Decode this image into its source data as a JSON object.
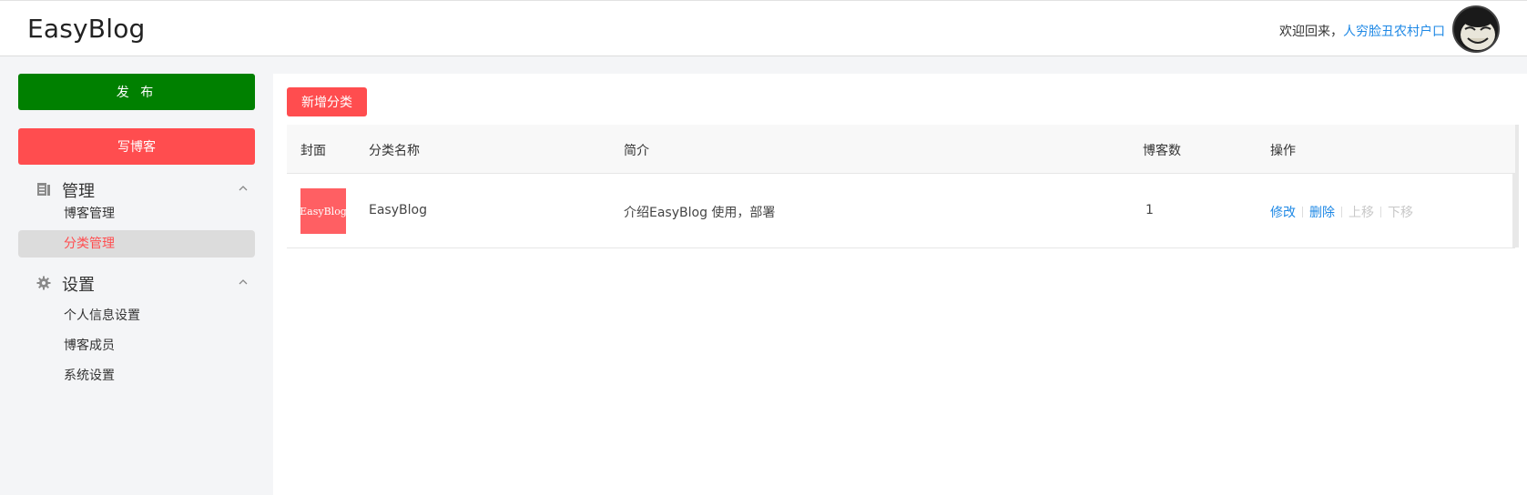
{
  "header": {
    "logo": "EasyBlog",
    "welcome_prefix": "欢迎回来，",
    "username": "人穷脸丑农村户口"
  },
  "sidebar": {
    "publish_label": "发 布",
    "write_label": "写博客",
    "groups": [
      {
        "label": "管理",
        "icon": "document-icon",
        "items": [
          {
            "label": "博客管理",
            "active": false
          },
          {
            "label": "分类管理",
            "active": true
          }
        ]
      },
      {
        "label": "设置",
        "icon": "gear-icon",
        "items": [
          {
            "label": "个人信息设置",
            "active": false
          },
          {
            "label": "博客成员",
            "active": false
          },
          {
            "label": "系统设置",
            "active": false
          }
        ]
      }
    ]
  },
  "main": {
    "add_button_label": "新增分类",
    "table": {
      "columns": [
        "封面",
        "分类名称",
        "简介",
        "博客数",
        "操作"
      ],
      "rows": [
        {
          "cover_text": "EasyBlog",
          "name": "EasyBlog",
          "intro": "介绍EasyBlog 使用，部署",
          "count": "1",
          "ops": [
            {
              "label": "修改",
              "enabled": true
            },
            {
              "label": "删除",
              "enabled": true
            },
            {
              "label": "上移",
              "enabled": false
            },
            {
              "label": "下移",
              "enabled": false
            }
          ]
        }
      ]
    }
  },
  "colors": {
    "publish_green": "#008000",
    "accent_red": "#ff4d4f",
    "link_blue": "#1e88e5",
    "sidebar_bg": "#f4f5f7"
  }
}
